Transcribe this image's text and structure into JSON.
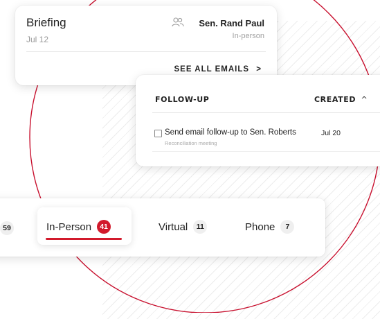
{
  "briefing": {
    "title": "Briefing",
    "date": "Jul 12",
    "attendee_name": "Sen. Rand Paul",
    "meeting_type": "In-person",
    "see_all_label": "SEE ALL EMAILS",
    "see_all_arrow": ">",
    "icon": "people-icon"
  },
  "followup": {
    "col_followup": "FOLLOW-UP",
    "col_created": "CREATED",
    "sort_glyph": "^",
    "task": {
      "title": "Send email follow-up to Sen. Roberts",
      "subtitle": "Reconciliation meeting",
      "date": "Jul 20",
      "checked": false
    }
  },
  "tabs": {
    "partial_count": "59",
    "items": [
      {
        "label": "In-Person",
        "count": "41",
        "active": true
      },
      {
        "label": "Virtual",
        "count": "11",
        "active": false
      },
      {
        "label": "Phone",
        "count": "7",
        "active": false
      }
    ]
  },
  "colors": {
    "accent": "#d21a2c",
    "text": "#222222",
    "muted": "#9a9a9a"
  }
}
